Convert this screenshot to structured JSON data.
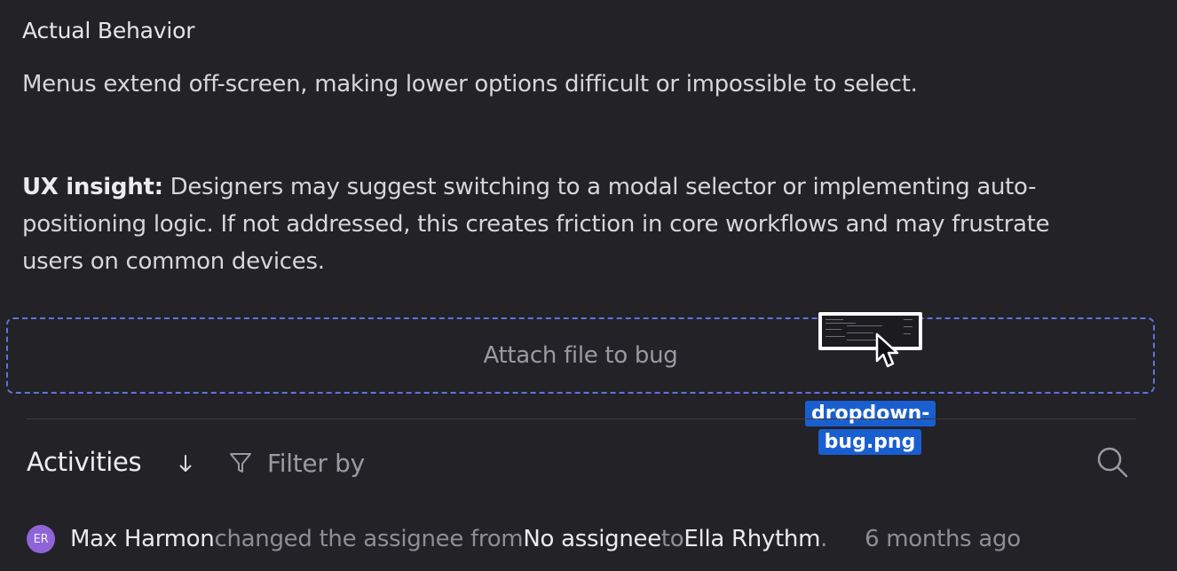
{
  "description": {
    "heading": "Actual Behavior",
    "actual_text": "Menus extend off-screen, making lower options difficult or impossible to select.",
    "ux_label": "UX insight:",
    "ux_text_line1": " Designers may suggest switching to a modal selector or implementing auto-",
    "ux_text_line2": "positioning logic. If not addressed, this creates friction in core workflows and may frustrate",
    "ux_text_line3": "users on common devices."
  },
  "attach": {
    "label": "Attach file to bug"
  },
  "drag": {
    "file_name_line1": "dropdown-",
    "file_name_line2": "bug.png"
  },
  "activities": {
    "title": "Activities",
    "filter_label": "Filter by",
    "sort_icon": "arrow-down-icon",
    "filter_icon": "funnel-icon",
    "search_icon": "search-icon",
    "items": [
      {
        "avatar_initials": "ER",
        "avatar_color": "#8f64d8",
        "actor": "Max Harmon",
        "action": " changed the assignee from ",
        "from": "No assignee",
        "to_word": " to ",
        "to": "Ella Rhythm",
        "period": ".",
        "time": "6 months ago"
      }
    ]
  },
  "colors": {
    "background": "#222227",
    "dropzone_border": "#5f73e0",
    "drag_label_bg": "#1a5fd0"
  }
}
